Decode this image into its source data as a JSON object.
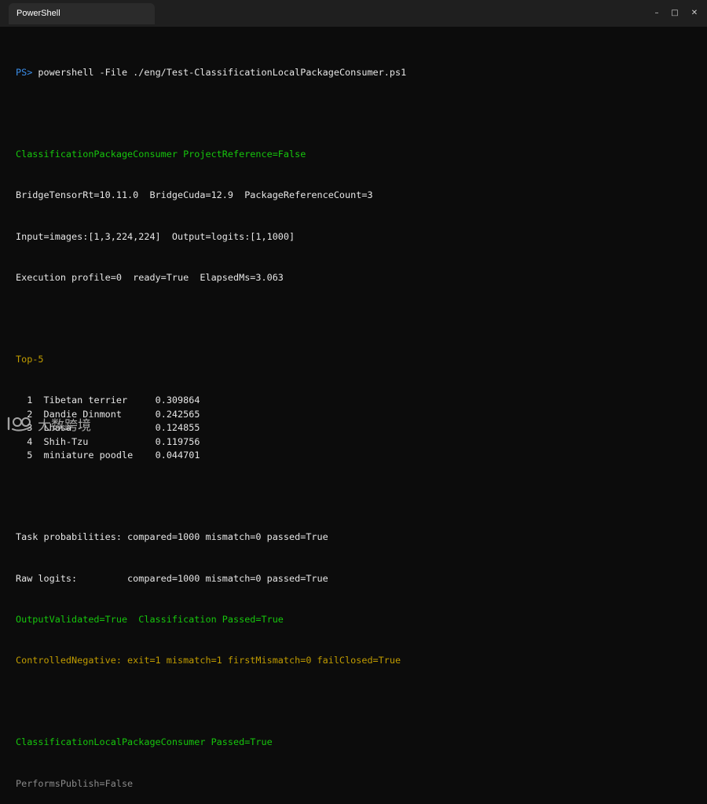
{
  "window": {
    "tab_title": "PowerShell",
    "controls": {
      "minimize": "–",
      "maximize": "□",
      "close": "✕"
    }
  },
  "colors": {
    "background": "#0c0c0c",
    "prompt": "#3b8eea",
    "success": "#16c60c",
    "warning": "#c19c00",
    "muted": "#8a8a8a"
  },
  "terminal": {
    "prompt": "PS>",
    "command": "powershell -File ./eng/Test-ClassificationLocalPackageConsumer.ps1",
    "header": "ClassificationPackageConsumer ProjectReference=False",
    "info_lines": [
      "BridgeTensorRt=10.11.0  BridgeCuda=12.9  PackageReferenceCount=3",
      "Input=images:[1,3,224,224]  Output=logits:[1,1000]",
      "Execution profile=0  ready=True  ElapsedMs=3.063"
    ],
    "top5_title": "Top-5",
    "top5": [
      {
        "rank": "1",
        "label": "Tibetan terrier",
        "score": "0.309864"
      },
      {
        "rank": "2",
        "label": "Dandie Dinmont",
        "score": "0.242565"
      },
      {
        "rank": "3",
        "label": "Lhasa",
        "score": "0.124855"
      },
      {
        "rank": "4",
        "label": "Shih-Tzu",
        "score": "0.119756"
      },
      {
        "rank": "5",
        "label": "miniature poodle",
        "score": "0.044701"
      }
    ],
    "comparisons": [
      "Task probabilities: compared=1000 mismatch=0 passed=True",
      "Raw logits:         compared=1000 mismatch=0 passed=True"
    ],
    "validated": "OutputValidated=True  Classification Passed=True",
    "controlled_negative": "ControlledNegative: exit=1 mismatch=1 firstMismatch=0 failClosed=True",
    "final_passed": "ClassificationLocalPackageConsumer Passed=True",
    "publish": "PerformsPublish=False"
  },
  "watermark": {
    "text": "大数跨境"
  }
}
